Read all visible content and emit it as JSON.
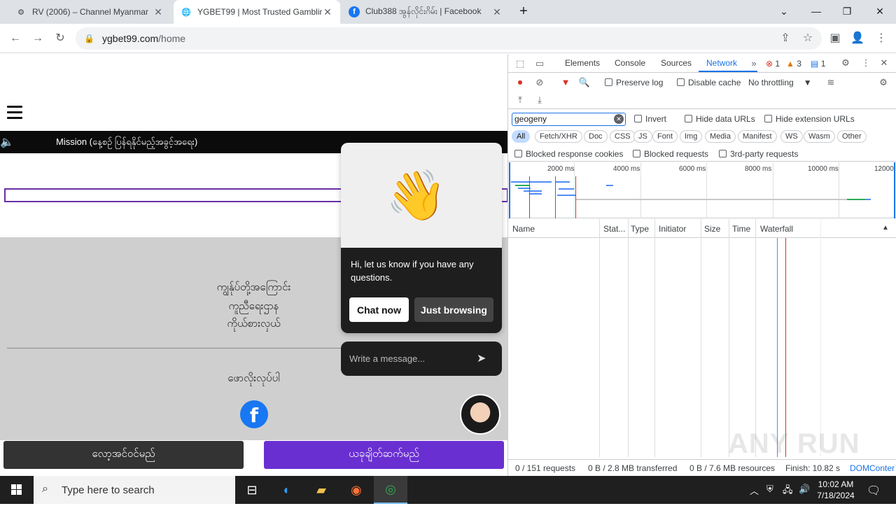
{
  "browser": {
    "tabs": [
      {
        "title": "RV (2006) – Channel Myanmar",
        "active": false
      },
      {
        "title": "YGBET99 | Most Trusted Gamblin",
        "active": true
      },
      {
        "title": "Club388 အွန်လိုင်းဂိမ်း | Facebook",
        "active": false
      }
    ],
    "url_host": "ygbet99.com",
    "url_path": "/home"
  },
  "page": {
    "marquee_text": "Mission (နေ့စဉ် ပြန်ရနိုင်မည့်အခွင့်အရေး)",
    "gray_lines": [
      "ကျွန်ုပ်တို့အကြောင်း",
      "ကူညီရေးဌာန",
      "ကိုယ်စားလှယ်"
    ],
    "follow_us": "ဖောလိုးလုပ်ပါ",
    "fb_letter": "f",
    "login_button": "လော့အင်ဝင်မည်",
    "register_button": "ယခုချိတ်ဆက်မည်",
    "login_color": "#333333",
    "register_color": "#6a2fd1"
  },
  "chat": {
    "message": "Hi, let us know if you have any questions.",
    "chat_now": "Chat now",
    "just_browsing": "Just browsing",
    "input_placeholder": "Write a message...",
    "wave_emoji": "👋"
  },
  "devtools": {
    "tabs": [
      "Elements",
      "Console",
      "Sources",
      "Network"
    ],
    "active_tab": "Network",
    "errors": "1",
    "warnings": "3",
    "messages": "1",
    "preserve_log": "Preserve log",
    "disable_cache": "Disable cache",
    "throttling": "No throttling",
    "filter_value": "geogeny",
    "invert": "Invert",
    "hide_data_urls": "Hide data URLs",
    "hide_extension_urls": "Hide extension URLs",
    "types": [
      "All",
      "Fetch/XHR",
      "Doc",
      "CSS",
      "JS",
      "Font",
      "Img",
      "Media",
      "Manifest",
      "WS",
      "Wasm",
      "Other"
    ],
    "blocked_response_cookies": "Blocked response cookies",
    "blocked_requests": "Blocked requests",
    "third_party": "3rd-party requests",
    "ticks": [
      "2000 ms",
      "4000 ms",
      "6000 ms",
      "8000 ms",
      "10000 ms",
      "12000"
    ],
    "columns": [
      "Name",
      "Stat...",
      "Type",
      "Initiator",
      "Size",
      "Time",
      "Waterfall"
    ],
    "status": {
      "requests": "0 / 151 requests",
      "transferred": "0 B / 2.8 MB transferred",
      "resources": "0 B / 7.6 MB resources",
      "finish": "Finish: 10.82 s",
      "domcontent": "DOMConter"
    }
  },
  "taskbar": {
    "search_placeholder": "Type here to search",
    "time": "10:02 AM",
    "date": "7/18/2024"
  },
  "watermark": "ANY RUN"
}
